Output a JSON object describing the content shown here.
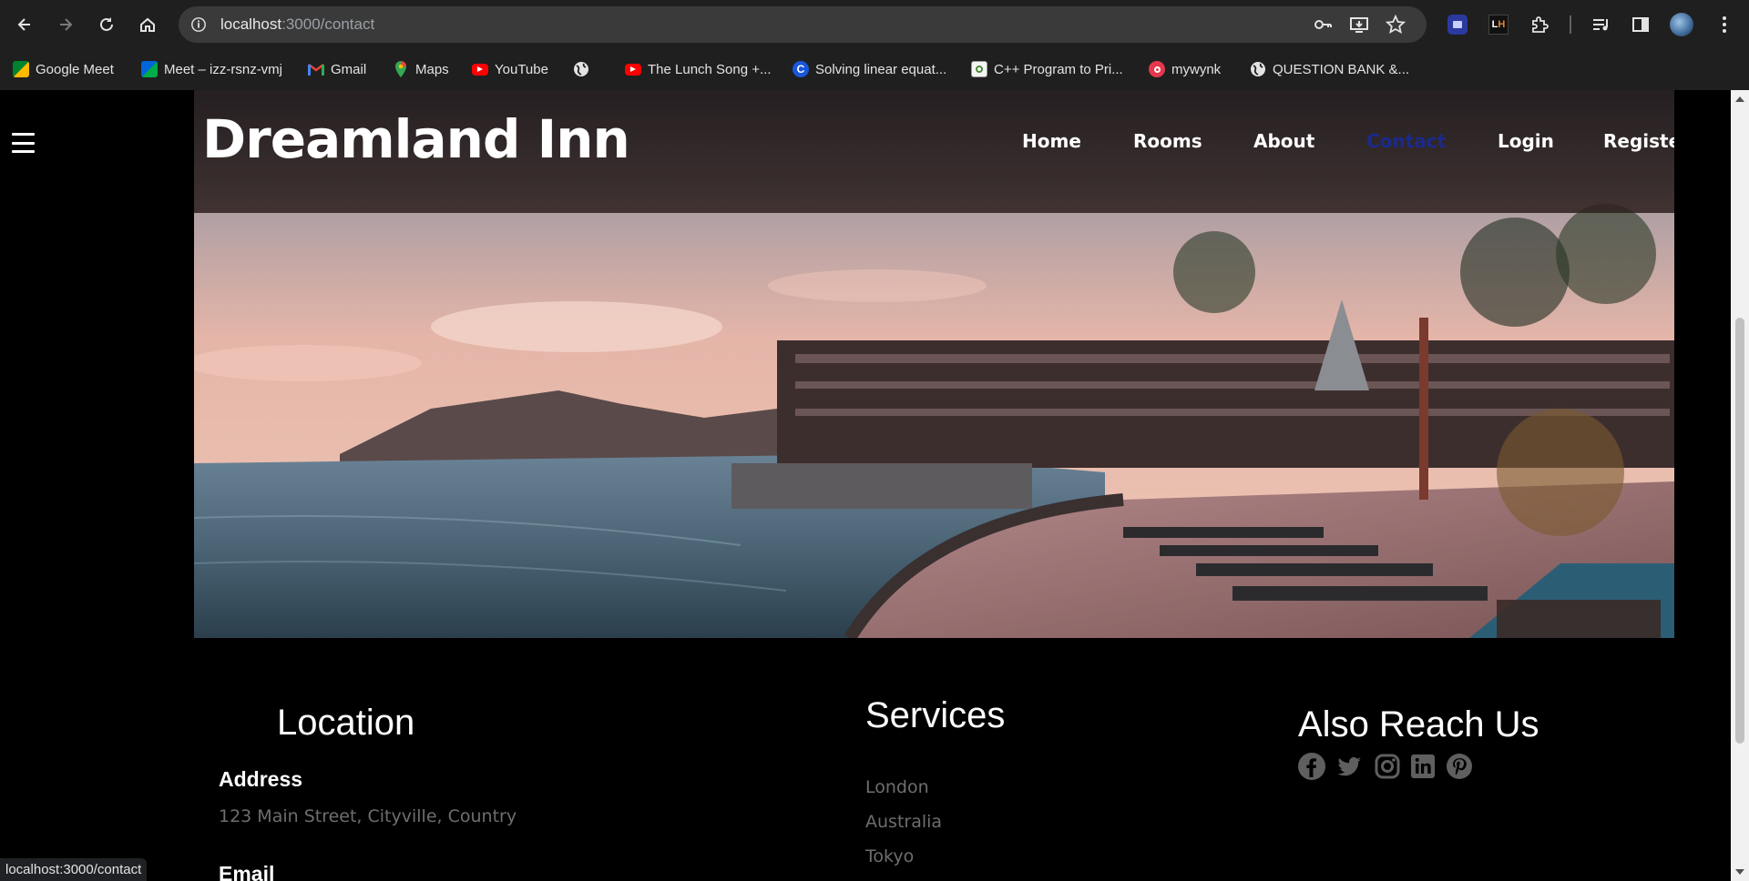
{
  "browser": {
    "url_host": "localhost",
    "url_path": ":3000/contact",
    "bookmarks": [
      {
        "label": "Google Meet",
        "icon": "google-meet-icon"
      },
      {
        "label": "Meet – izz-rsnz-vmj",
        "icon": "google-meet-icon"
      },
      {
        "label": "Gmail",
        "icon": "gmail-icon"
      },
      {
        "label": "Maps",
        "icon": "maps-icon"
      },
      {
        "label": "YouTube",
        "icon": "youtube-icon"
      },
      {
        "label": "",
        "icon": "globe-icon"
      },
      {
        "label": "The Lunch Song +...",
        "icon": "youtube-icon"
      },
      {
        "label": "Solving linear equat...",
        "icon": "c-logo-icon"
      },
      {
        "label": "C++ Program to Pri...",
        "icon": "page-icon"
      },
      {
        "label": "mywynk",
        "icon": "wynk-icon"
      },
      {
        "label": "QUESTION BANK &...",
        "icon": "globe-icon"
      }
    ],
    "status_text": "localhost:3000/contact"
  },
  "site": {
    "title": "Dreamland Inn",
    "nav": [
      "Home",
      "Rooms",
      "About",
      "Contact",
      "Login",
      "Register"
    ],
    "active_nav": "Contact",
    "active_color": "#1a2a8c"
  },
  "footer": {
    "location": {
      "title": "Location",
      "address_label": "Address",
      "address": "123 Main Street, Cityville, Country",
      "email_label": "Email"
    },
    "services": {
      "title": "Services",
      "items": [
        "London",
        "Australia",
        "Tokyo"
      ]
    },
    "reach": {
      "title": "Also Reach Us",
      "icons": [
        "facebook-icon",
        "twitter-icon",
        "instagram-icon",
        "linkedin-icon",
        "pinterest-icon"
      ]
    }
  }
}
